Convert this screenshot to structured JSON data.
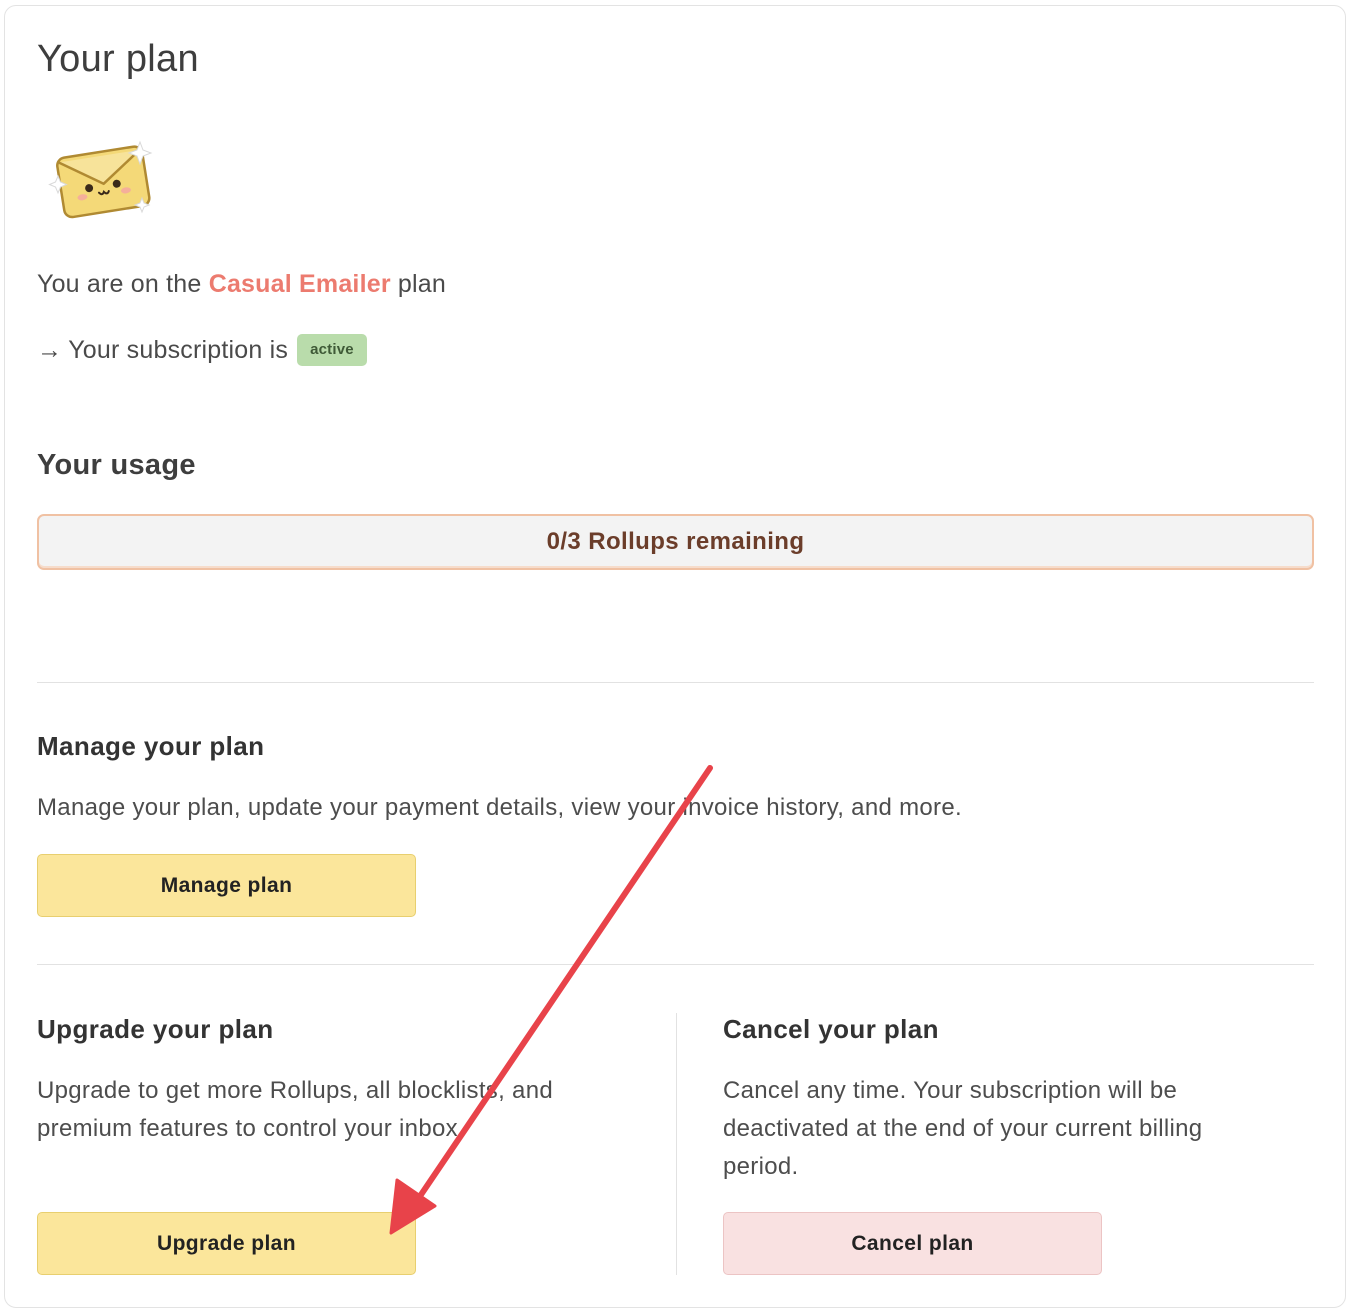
{
  "plan": {
    "title": "Your plan",
    "plan_prefix": "You are on the",
    "plan_name": "Casual Emailer",
    "plan_suffix": "plan",
    "subscription_arrow": "→",
    "subscription_text": "Your subscription is",
    "status_badge": "active"
  },
  "usage": {
    "title": "Your usage",
    "label": "0/3 Rollups remaining",
    "used_fraction": 0
  },
  "manage": {
    "title": "Manage your plan",
    "description": "Manage your plan, update your payment details, view your invoice history, and more.",
    "button": "Manage plan"
  },
  "upgrade": {
    "title": "Upgrade your plan",
    "description_line1": "Upgrade to get more Rollups, all blocklists, and",
    "description_line2": "premium features to control your inbox.",
    "button": "Upgrade plan"
  },
  "cancel": {
    "title": "Cancel your plan",
    "description_line1": "Cancel any time. Your subscription will be",
    "description_line2": "deactivated at the end of your current billing",
    "description_line3": "period.",
    "button": "Cancel plan"
  },
  "colors": {
    "accent": "#ec7b6f",
    "button_yellow": "#fbe69b",
    "button_pink": "#f9e1e1",
    "badge_green": "#b9dcab",
    "annotation_red": "#e8434a"
  },
  "icons": {
    "mascot": "kawaii-envelope-icon",
    "annotation": "red-arrow-annotation"
  }
}
